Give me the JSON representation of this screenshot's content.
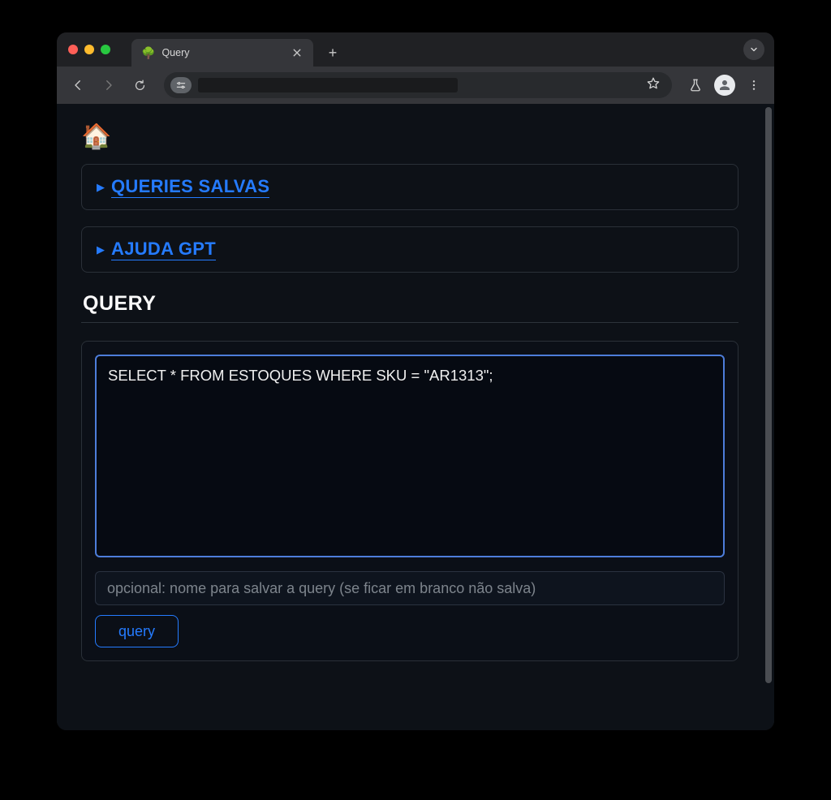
{
  "browser": {
    "tab": {
      "favicon": "🌳",
      "title": "Query"
    },
    "newtab_label": "+",
    "nav": {
      "back": "←",
      "forward": "→"
    },
    "dropdown_glyph": "⌄"
  },
  "page": {
    "home_emoji": "🏠",
    "collapsibles": [
      {
        "id": "queries-salvas",
        "label": "QUERIES SALVAS"
      },
      {
        "id": "ajuda-gpt",
        "label": "AJUDA GPT"
      }
    ],
    "section_heading": "QUERY",
    "form": {
      "sql_value": "SELECT * FROM ESTOQUES WHERE SKU = \"AR1313\";",
      "name_placeholder": "opcional: nome para salvar a query (se ficar em branco não salva)",
      "submit_label": "query"
    }
  }
}
